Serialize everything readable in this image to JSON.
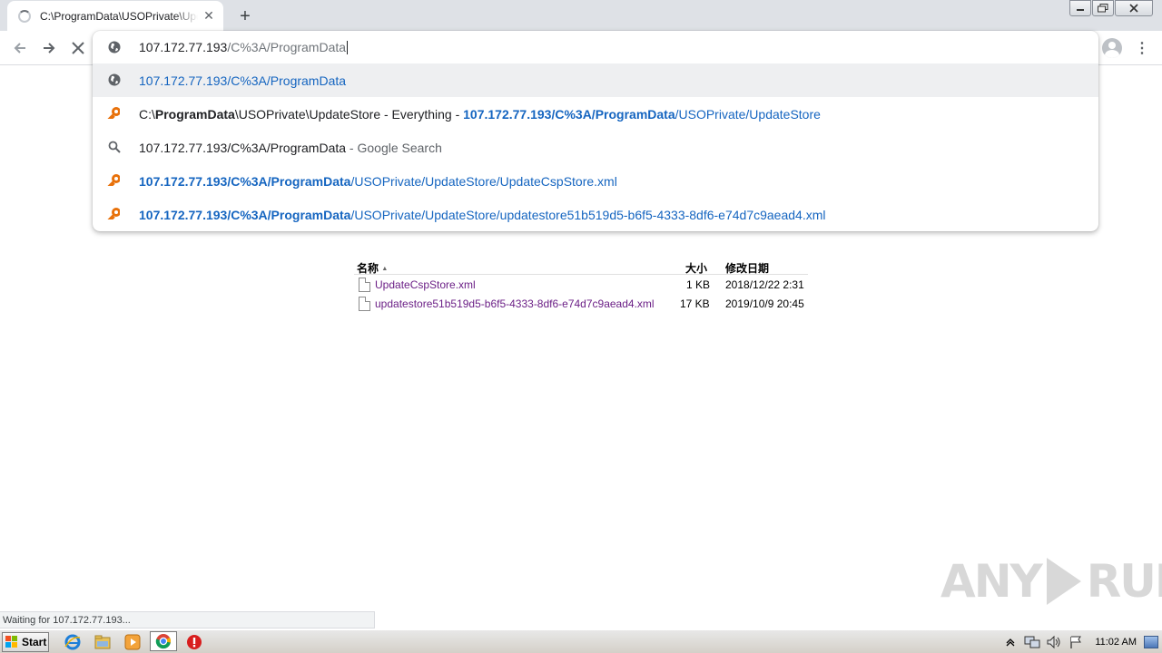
{
  "window": {
    "tab_title": "C:\\ProgramData\\USOPrivate\\UpdateStore",
    "tab_close_glyph": "✕",
    "new_tab_glyph": "+"
  },
  "toolbar": {
    "back_glyph": "←",
    "forward_glyph": "→",
    "stop_glyph": "✕",
    "menu_glyph": "⋮"
  },
  "omnibox": {
    "input_bold": "107.172.77.193",
    "input_rest": "/C%3A/ProgramData",
    "suggestions": [
      {
        "icon": "globe-icon",
        "main": "107.172.77.193/C%3A/ProgramData"
      },
      {
        "icon": "key-icon",
        "title_pre": "C:\\",
        "title_bold": "ProgramData",
        "title_post": "\\USOPrivate\\UpdateStore - Everything - ",
        "url_bold": "107.172.77.193/C%3A/ProgramData",
        "url_rest": "/USOPrivate/UpdateStore"
      },
      {
        "icon": "search-icon",
        "query": "107.172.77.193/C%3A/ProgramData",
        "suffix": " - Google Search"
      },
      {
        "icon": "key-icon",
        "url_bold": "107.172.77.193/C%3A/ProgramData",
        "url_rest": "/USOPrivate/UpdateStore/UpdateCspStore.xml"
      },
      {
        "icon": "key-icon",
        "url_bold": "107.172.77.193/C%3A/ProgramData",
        "url_rest": "/USOPrivate/UpdateStore/updatestore51b519d5-b6f5-4333-8df6-e74d7c9aead4.xml"
      }
    ]
  },
  "listing": {
    "headers": {
      "name": "名称",
      "sort_glyph": "▲",
      "size": "大小",
      "modified": "修改日期"
    },
    "files": [
      {
        "name": "UpdateCspStore.xml",
        "size": "1 KB",
        "modified": "2018/12/22 2:31"
      },
      {
        "name": "updatestore51b519d5-b6f5-4333-8df6-e74d7c9aead4.xml",
        "size": "17 KB",
        "modified": "2019/10/9 20:45"
      }
    ]
  },
  "status_text": "Waiting for 107.172.77.193...",
  "watermark": {
    "left": "ANY",
    "right": "RUN"
  },
  "taskbar": {
    "start_label": "Start",
    "clock": "11:02 AM"
  }
}
